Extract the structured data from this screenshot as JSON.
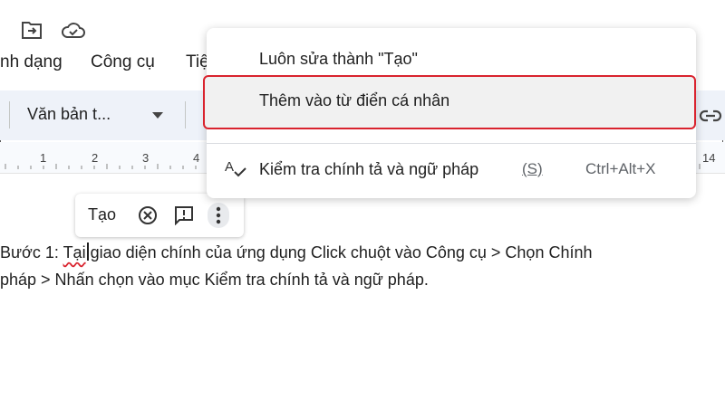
{
  "header": {
    "menus": [
      "nh dạng",
      "Công cụ",
      "Tiệ"
    ]
  },
  "toolbar": {
    "style_dropdown": "Văn bản t..."
  },
  "ruler": {
    "numbers": [
      "1",
      "2",
      "3",
      "4",
      "14"
    ]
  },
  "popup": {
    "item1": "Luôn sửa thành \"Tạo\"",
    "item2": "Thêm vào từ điển cá nhân",
    "item3_label": "Kiểm tra chính tả và ngữ pháp",
    "item3_hint": "(S)",
    "item3_shortcut": "Ctrl+Alt+X"
  },
  "suggestion_chip": {
    "word": "Tạo"
  },
  "document": {
    "line1_prefix": "Bước 1: ",
    "line1_misspelled": "Tại",
    "line1_rest": "giao diện chính của ứng dụng Click chuột vào Công cụ > Chọn Chính",
    "line2": "pháp > Nhấn chọn vào mục Kiểm tra chính tả và ngữ pháp."
  },
  "colors": {
    "highlight_border": "#d9232e",
    "toolbar_bg": "#eef2f9"
  }
}
